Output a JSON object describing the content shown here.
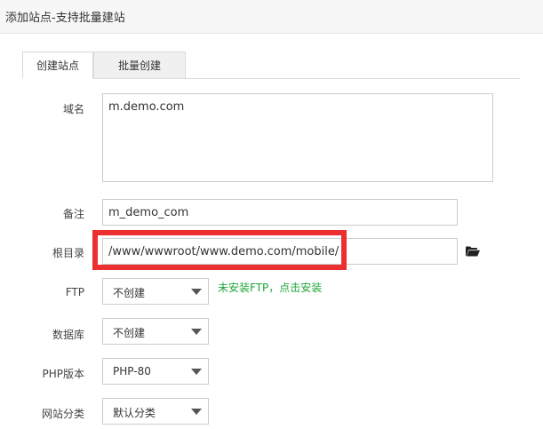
{
  "dialog": {
    "title": "添加站点-支持批量建站"
  },
  "tabs": [
    {
      "label": "创建站点",
      "active": true
    },
    {
      "label": "批量创建",
      "active": false
    }
  ],
  "form": {
    "domain": {
      "label": "域名",
      "value": "m.demo.com"
    },
    "remark": {
      "label": "备注",
      "value": "m_demo_com"
    },
    "root": {
      "label": "根目录",
      "value": "/www/wwwroot/www.demo.com/mobile/",
      "icon": "folder-open-icon"
    },
    "ftp": {
      "label": "FTP",
      "selected": "不创建",
      "hint": "未安装FTP，点击安装"
    },
    "database": {
      "label": "数据库",
      "selected": "不创建"
    },
    "php": {
      "label": "PHP版本",
      "selected": "PHP-80"
    },
    "category": {
      "label": "网站分类",
      "selected": "默认分类"
    }
  },
  "colors": {
    "hint": "#20a53a",
    "highlight": "#ec2f31"
  }
}
